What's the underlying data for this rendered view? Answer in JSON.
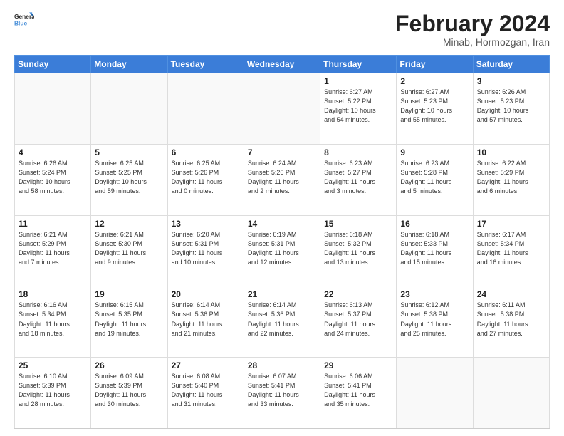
{
  "header": {
    "logo_line1": "General",
    "logo_line2": "Blue",
    "month_title": "February 2024",
    "subtitle": "Minab, Hormozgan, Iran"
  },
  "weekdays": [
    "Sunday",
    "Monday",
    "Tuesday",
    "Wednesday",
    "Thursday",
    "Friday",
    "Saturday"
  ],
  "weeks": [
    [
      {
        "day": "",
        "info": ""
      },
      {
        "day": "",
        "info": ""
      },
      {
        "day": "",
        "info": ""
      },
      {
        "day": "",
        "info": ""
      },
      {
        "day": "1",
        "info": "Sunrise: 6:27 AM\nSunset: 5:22 PM\nDaylight: 10 hours\nand 54 minutes."
      },
      {
        "day": "2",
        "info": "Sunrise: 6:27 AM\nSunset: 5:23 PM\nDaylight: 10 hours\nand 55 minutes."
      },
      {
        "day": "3",
        "info": "Sunrise: 6:26 AM\nSunset: 5:23 PM\nDaylight: 10 hours\nand 57 minutes."
      }
    ],
    [
      {
        "day": "4",
        "info": "Sunrise: 6:26 AM\nSunset: 5:24 PM\nDaylight: 10 hours\nand 58 minutes."
      },
      {
        "day": "5",
        "info": "Sunrise: 6:25 AM\nSunset: 5:25 PM\nDaylight: 10 hours\nand 59 minutes."
      },
      {
        "day": "6",
        "info": "Sunrise: 6:25 AM\nSunset: 5:26 PM\nDaylight: 11 hours\nand 0 minutes."
      },
      {
        "day": "7",
        "info": "Sunrise: 6:24 AM\nSunset: 5:26 PM\nDaylight: 11 hours\nand 2 minutes."
      },
      {
        "day": "8",
        "info": "Sunrise: 6:23 AM\nSunset: 5:27 PM\nDaylight: 11 hours\nand 3 minutes."
      },
      {
        "day": "9",
        "info": "Sunrise: 6:23 AM\nSunset: 5:28 PM\nDaylight: 11 hours\nand 5 minutes."
      },
      {
        "day": "10",
        "info": "Sunrise: 6:22 AM\nSunset: 5:29 PM\nDaylight: 11 hours\nand 6 minutes."
      }
    ],
    [
      {
        "day": "11",
        "info": "Sunrise: 6:21 AM\nSunset: 5:29 PM\nDaylight: 11 hours\nand 7 minutes."
      },
      {
        "day": "12",
        "info": "Sunrise: 6:21 AM\nSunset: 5:30 PM\nDaylight: 11 hours\nand 9 minutes."
      },
      {
        "day": "13",
        "info": "Sunrise: 6:20 AM\nSunset: 5:31 PM\nDaylight: 11 hours\nand 10 minutes."
      },
      {
        "day": "14",
        "info": "Sunrise: 6:19 AM\nSunset: 5:31 PM\nDaylight: 11 hours\nand 12 minutes."
      },
      {
        "day": "15",
        "info": "Sunrise: 6:18 AM\nSunset: 5:32 PM\nDaylight: 11 hours\nand 13 minutes."
      },
      {
        "day": "16",
        "info": "Sunrise: 6:18 AM\nSunset: 5:33 PM\nDaylight: 11 hours\nand 15 minutes."
      },
      {
        "day": "17",
        "info": "Sunrise: 6:17 AM\nSunset: 5:34 PM\nDaylight: 11 hours\nand 16 minutes."
      }
    ],
    [
      {
        "day": "18",
        "info": "Sunrise: 6:16 AM\nSunset: 5:34 PM\nDaylight: 11 hours\nand 18 minutes."
      },
      {
        "day": "19",
        "info": "Sunrise: 6:15 AM\nSunset: 5:35 PM\nDaylight: 11 hours\nand 19 minutes."
      },
      {
        "day": "20",
        "info": "Sunrise: 6:14 AM\nSunset: 5:36 PM\nDaylight: 11 hours\nand 21 minutes."
      },
      {
        "day": "21",
        "info": "Sunrise: 6:14 AM\nSunset: 5:36 PM\nDaylight: 11 hours\nand 22 minutes."
      },
      {
        "day": "22",
        "info": "Sunrise: 6:13 AM\nSunset: 5:37 PM\nDaylight: 11 hours\nand 24 minutes."
      },
      {
        "day": "23",
        "info": "Sunrise: 6:12 AM\nSunset: 5:38 PM\nDaylight: 11 hours\nand 25 minutes."
      },
      {
        "day": "24",
        "info": "Sunrise: 6:11 AM\nSunset: 5:38 PM\nDaylight: 11 hours\nand 27 minutes."
      }
    ],
    [
      {
        "day": "25",
        "info": "Sunrise: 6:10 AM\nSunset: 5:39 PM\nDaylight: 11 hours\nand 28 minutes."
      },
      {
        "day": "26",
        "info": "Sunrise: 6:09 AM\nSunset: 5:39 PM\nDaylight: 11 hours\nand 30 minutes."
      },
      {
        "day": "27",
        "info": "Sunrise: 6:08 AM\nSunset: 5:40 PM\nDaylight: 11 hours\nand 31 minutes."
      },
      {
        "day": "28",
        "info": "Sunrise: 6:07 AM\nSunset: 5:41 PM\nDaylight: 11 hours\nand 33 minutes."
      },
      {
        "day": "29",
        "info": "Sunrise: 6:06 AM\nSunset: 5:41 PM\nDaylight: 11 hours\nand 35 minutes."
      },
      {
        "day": "",
        "info": ""
      },
      {
        "day": "",
        "info": ""
      }
    ]
  ]
}
